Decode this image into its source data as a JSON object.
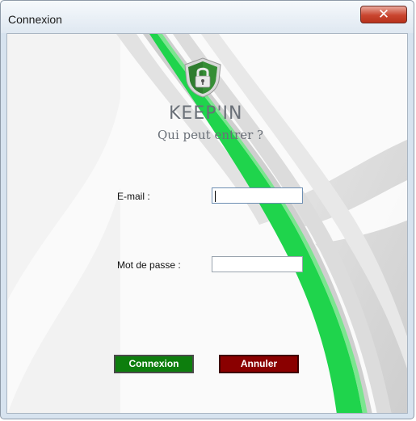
{
  "window": {
    "title": "Connexion",
    "close_glyph": "✕"
  },
  "branding": {
    "logo_icon": "shield-padlock-icon",
    "app_name": "KEEP'IN",
    "tagline": "Qui peut entrer ?"
  },
  "form": {
    "email_label": "E-mail :",
    "email_value": "",
    "password_label": "Mot de passe :",
    "password_value": ""
  },
  "buttons": {
    "submit_label": "Connexion",
    "cancel_label": "Annuler"
  },
  "colors": {
    "accent_green": "#1fd44c",
    "shield_green": "#2f7d2f",
    "submit_bg": "#0d7e0d",
    "cancel_bg": "#8a0000"
  }
}
